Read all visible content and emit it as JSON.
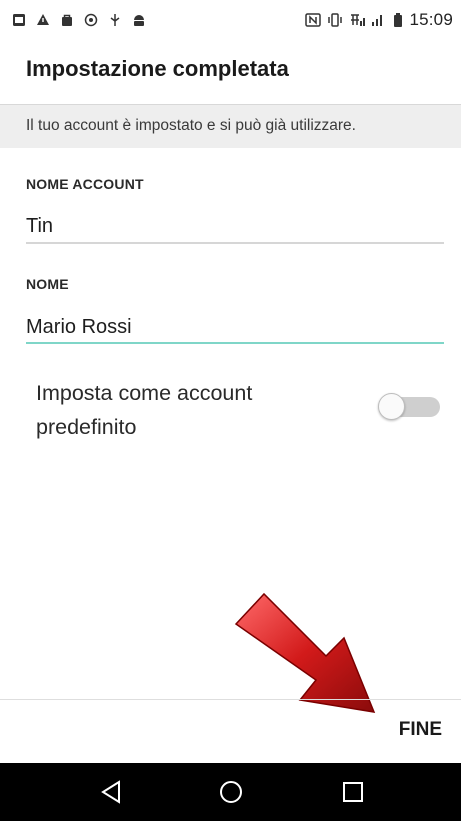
{
  "status_bar": {
    "time": "15:09",
    "left_icons": [
      "image-notification-icon",
      "warning-notification-icon",
      "bag-notification-icon",
      "sync-notification-icon",
      "usb-icon",
      "android-debug-icon"
    ],
    "right_icons": [
      "nfc-icon",
      "vibrate-icon",
      "wifi-calling-icon",
      "signal-icon",
      "battery-icon"
    ]
  },
  "header": {
    "title": "Impostazione completata"
  },
  "banner": {
    "text": "Il tuo account è impostato e si può già utilizzare."
  },
  "form": {
    "account_name_label": "NOME ACCOUNT",
    "account_name_value": "Tin",
    "name_label": "NOME",
    "name_value": "Mario Rossi",
    "default_toggle_label": "Imposta come account predefinito",
    "default_toggle_on": false
  },
  "footer": {
    "done_label": "FINE"
  },
  "nav_bar": {
    "icons": [
      "back-icon",
      "home-icon",
      "recents-icon"
    ]
  },
  "colors": {
    "active_underline": "#7fd6c8",
    "arrow_red": "#d21a1a",
    "nav_bar_bg": "#000000"
  }
}
